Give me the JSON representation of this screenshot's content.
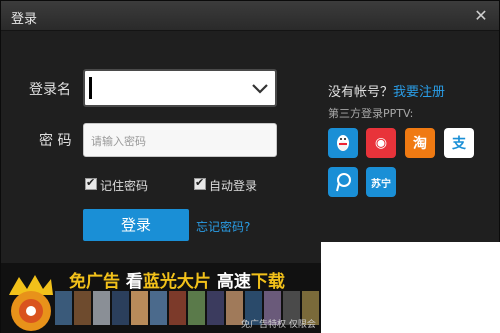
{
  "window": {
    "title": "登录",
    "close_symbol": "✕"
  },
  "form": {
    "username_label": "登录名",
    "username_value": "",
    "password_label": "密 码",
    "password_placeholder": "请输入密码",
    "remember_label": "记住密码",
    "remember_checked": true,
    "autologin_label": "自动登录",
    "autologin_checked": true,
    "login_button": "登录",
    "forgot_link": "忘记密码?"
  },
  "right_panel": {
    "no_account": "没有帐号？",
    "register_link": "我要注册",
    "third_party_label": "第三方登录PPTV:",
    "providers": [
      {
        "name": "qq",
        "icon": "qq-penguin-icon",
        "color": "#1a8fd6"
      },
      {
        "name": "weibo",
        "icon": "weibo-icon",
        "color": "#e8333a",
        "glyph": "◉"
      },
      {
        "name": "taobao",
        "icon": "taobao-icon",
        "color": "#f07a12",
        "glyph": "淘"
      },
      {
        "name": "alipay",
        "icon": "alipay-icon",
        "color": "#ffffff",
        "glyph": "支"
      },
      {
        "name": "pptv",
        "icon": "pptv-p-icon",
        "color": "#1a8fd6"
      },
      {
        "name": "suning",
        "icon": "suning-icon",
        "color": "#1a8fd6",
        "glyph": "苏宁"
      }
    ]
  },
  "banner": {
    "free_ad": "免广告",
    "bluray_see": "看",
    "bluray": "蓝光大片",
    "speed": "高速",
    "download": "下载",
    "ad_note": "免广告特权 仅限会"
  }
}
